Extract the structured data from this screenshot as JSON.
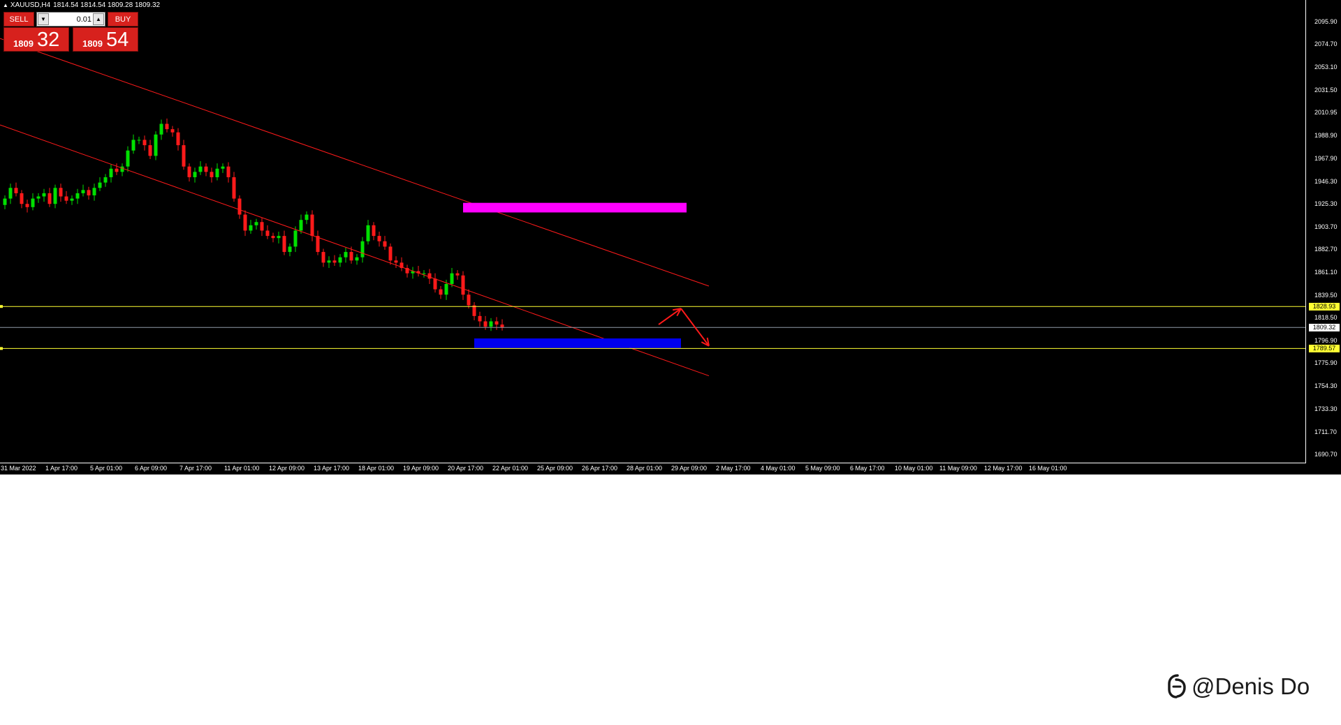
{
  "symbol_bar": {
    "symbol": "XAUUSD,H4",
    "ohlc": "1814.54 1814.54 1809.28 1809.32"
  },
  "trade_panel": {
    "sell_label": "SELL",
    "buy_label": "BUY",
    "lot_value": "0.01",
    "sell_price_small": "1809",
    "sell_price_big": "32",
    "buy_price_small": "1809",
    "buy_price_big": "54"
  },
  "price_markers": {
    "resistance": "1828.93",
    "current": "1809.32",
    "support": "1789.57"
  },
  "watermark": {
    "text": "@Denis Do"
  },
  "colors": {
    "background": "#000000",
    "bull_candle": "#00e000",
    "bear_candle": "#ff1a1a",
    "channel": "#ff1a1a",
    "supply_zone": "#ff00ff",
    "demand_zone": "#0000ee",
    "level_line": "#ffff33",
    "bid_line": "#8f9aa8"
  },
  "chart_data": {
    "type": "candlestick",
    "symbol": "XAUUSD",
    "timeframe": "H4",
    "ylim": [
      1682,
      2116
    ],
    "y_ticks": [
      "2095.90",
      "2074.70",
      "2053.10",
      "2031.50",
      "2010.95",
      "1988.90",
      "1967.90",
      "1946.30",
      "1925.30",
      "1903.70",
      "1882.70",
      "1861.10",
      "1839.50",
      "1818.50",
      "1796.90",
      "1775.90",
      "1754.30",
      "1733.30",
      "1711.70",
      "1690.70"
    ],
    "x_ticks": [
      "31 Mar 2022",
      "1 Apr 17:00",
      "5 Apr 01:00",
      "6 Apr 09:00",
      "7 Apr 17:00",
      "11 Apr 01:00",
      "12 Apr 09:00",
      "13 Apr 17:00",
      "18 Apr 01:00",
      "19 Apr 09:00",
      "20 Apr 17:00",
      "22 Apr 01:00",
      "25 Apr 09:00",
      "26 Apr 17:00",
      "28 Apr 01:00",
      "29 Apr 09:00",
      "2 May 17:00",
      "4 May 01:00",
      "5 May 09:00",
      "6 May 17:00",
      "10 May 01:00",
      "11 May 09:00",
      "12 May 17:00",
      "16 May 01:00"
    ],
    "bars_per_tick": 8,
    "close_path": [
      1930,
      1940,
      1935,
      1925,
      1922,
      1930,
      1932,
      1935,
      1925,
      1940,
      1932,
      1928,
      1930,
      1935,
      1938,
      1933,
      1940,
      1945,
      1950,
      1958,
      1955,
      1960,
      1975,
      1985,
      1985,
      1980,
      1970,
      1990,
      2000,
      1995,
      1992,
      1980,
      1960,
      1950,
      1955,
      1960,
      1955,
      1950,
      1958,
      1960,
      1950,
      1930,
      1915,
      1900,
      1905,
      1908,
      1900,
      1895,
      1893,
      1895,
      1880,
      1885,
      1900,
      1910,
      1915,
      1895,
      1880,
      1870,
      1872,
      1870,
      1875,
      1880,
      1872,
      1875,
      1890,
      1905,
      1895,
      1890,
      1885,
      1872,
      1870,
      1865,
      1860,
      1862,
      1860,
      1860,
      1855,
      1845,
      1840,
      1850,
      1860,
      1858,
      1840,
      1830,
      1820,
      1815,
      1810,
      1815,
      1812,
      1809.32
    ],
    "levels": [
      1828.93,
      1809.32,
      1789.57
    ],
    "channel_upper": [
      [
        0,
        2080
      ],
      [
        126,
        1848
      ]
    ],
    "channel_lower": [
      [
        0,
        1999
      ],
      [
        126,
        1764
      ]
    ],
    "zones": [
      {
        "name": "supply",
        "x_start_bar": 82,
        "x_end_bar": 122,
        "y_low": 1917,
        "y_high": 1926
      },
      {
        "name": "demand",
        "x_start_bar": 84,
        "x_end_bar": 121,
        "y_low": 1790,
        "y_high": 1799
      }
    ],
    "projection": [
      [
        117,
        1812
      ],
      [
        121,
        1827
      ],
      [
        126,
        1792
      ]
    ]
  }
}
